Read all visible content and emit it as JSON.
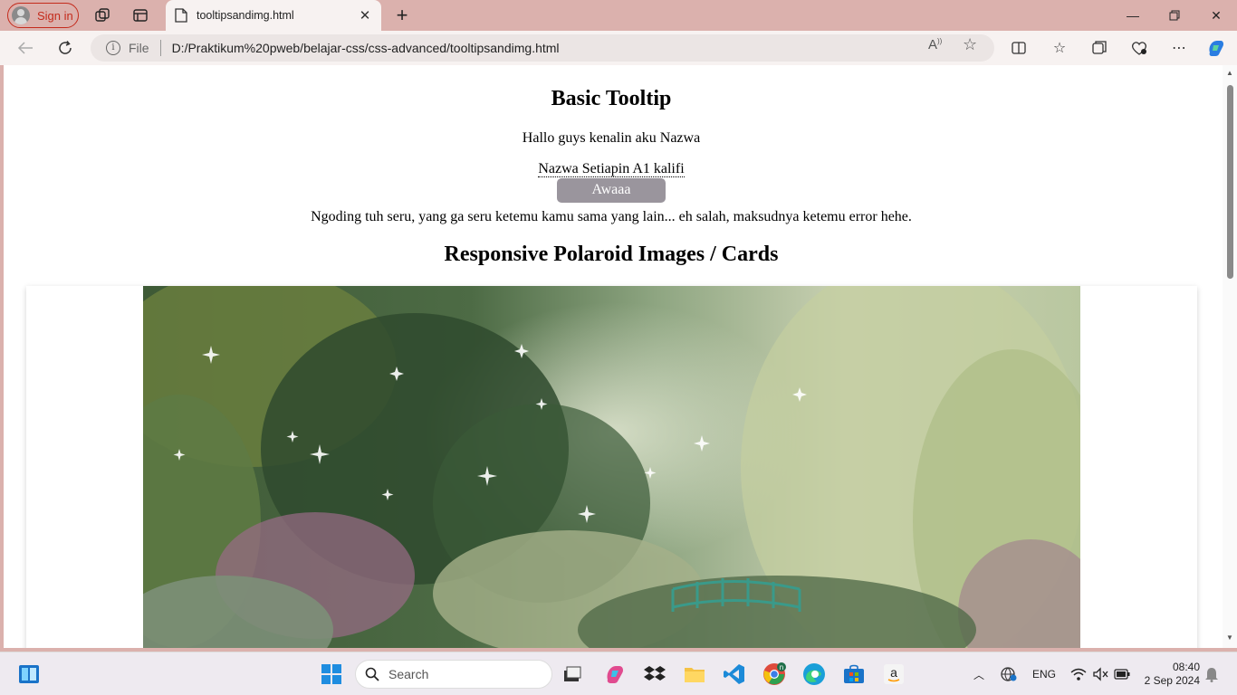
{
  "browser": {
    "signin_label": "Sign in",
    "tab_title": "tooltipsandimg.html",
    "address": {
      "scheme_label": "File",
      "url": "D:/Praktikum%20pweb/belajar-css/css-advanced/tooltipsandimg.html"
    }
  },
  "page": {
    "heading_tooltip": "Basic Tooltip",
    "intro": "Hallo guys kenalin aku Nazwa",
    "tooltip_target": "Nazwa Setiapin A1 kalifi",
    "tooltip_text": "Awaaa",
    "paragraph": "Ngoding tuh seru, yang ga seru ketemu kamu sama yang lain... eh salah, maksudnya ketemu error hehe.",
    "heading_polaroid": "Responsive Polaroid Images / Cards"
  },
  "taskbar": {
    "search_placeholder": "Search",
    "language": "ENG",
    "time": "08:40",
    "date": "2 Sep 2024",
    "chrome_badge": "n"
  },
  "colors": {
    "frame": "#dbb1ad",
    "tooltip_bg": "#9a959d",
    "signin": "#c42b1c"
  }
}
